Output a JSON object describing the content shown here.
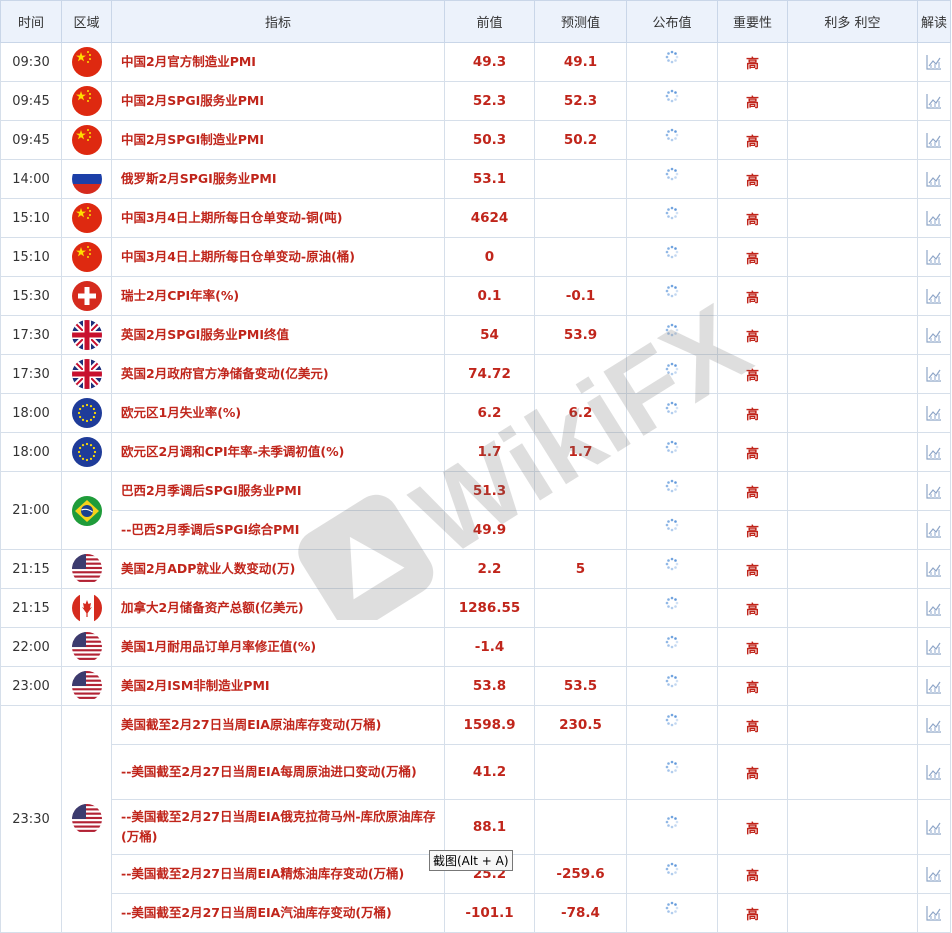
{
  "headers": {
    "time": "时间",
    "region": "区域",
    "indicator": "指标",
    "prev": "前值",
    "forecast": "预测值",
    "actual": "公布值",
    "importance": "重要性",
    "impact": "利多 利空",
    "analysis": "解读"
  },
  "rows": [
    {
      "time": "09:30",
      "name": "中国2月官方制造业PMI",
      "prev": "49.3",
      "forecast": "49.1",
      "importance": "高"
    },
    {
      "time": "09:45",
      "name": "中国2月SPGI服务业PMI",
      "prev": "52.3",
      "forecast": "52.3",
      "importance": "高"
    },
    {
      "time": "09:45",
      "name": "中国2月SPGI制造业PMI",
      "prev": "50.3",
      "forecast": "50.2",
      "importance": "高"
    },
    {
      "time": "14:00",
      "name": "俄罗斯2月SPGI服务业PMI",
      "prev": "53.1",
      "forecast": "",
      "importance": "高"
    },
    {
      "time": "15:10",
      "name": "中国3月4日上期所每日仓单变动-铜(吨)",
      "prev": "4624",
      "forecast": "",
      "importance": "高"
    },
    {
      "time": "15:10",
      "name": "中国3月4日上期所每日仓单变动-原油(桶)",
      "prev": "0",
      "forecast": "",
      "importance": "高"
    },
    {
      "time": "15:30",
      "name": "瑞士2月CPI年率(%)",
      "prev": "0.1",
      "forecast": "-0.1",
      "importance": "高"
    },
    {
      "time": "17:30",
      "name": "英国2月SPGI服务业PMI终值",
      "prev": "54",
      "forecast": "53.9",
      "importance": "高"
    },
    {
      "time": "17:30",
      "name": "英国2月政府官方净储备变动(亿美元)",
      "prev": "74.72",
      "forecast": "",
      "importance": "高"
    },
    {
      "time": "18:00",
      "name": "欧元区1月失业率(%)",
      "prev": "6.2",
      "forecast": "6.2",
      "importance": "高"
    },
    {
      "time": "18:00",
      "name": "欧元区2月调和CPI年率-未季调初值(%)",
      "prev": "1.7",
      "forecast": "1.7",
      "importance": "高"
    },
    {
      "time": "21:00",
      "name": "巴西2月季调后SPGI服务业PMI",
      "prev": "51.3",
      "forecast": "",
      "importance": "高"
    },
    {
      "time": "",
      "name": "--巴西2月季调后SPGI综合PMI",
      "prev": "49.9",
      "forecast": "",
      "importance": "高"
    },
    {
      "time": "21:15",
      "name": "美国2月ADP就业人数变动(万)",
      "prev": "2.2",
      "forecast": "5",
      "importance": "高"
    },
    {
      "time": "21:15",
      "name": "加拿大2月储备资产总额(亿美元)",
      "prev": "1286.55",
      "forecast": "",
      "importance": "高"
    },
    {
      "time": "22:00",
      "name": "美国1月耐用品订单月率修正值(%)",
      "prev": "-1.4",
      "forecast": "",
      "importance": "高"
    },
    {
      "time": "23:00",
      "name": "美国2月ISM非制造业PMI",
      "prev": "53.8",
      "forecast": "53.5",
      "importance": "高"
    },
    {
      "time": "23:30",
      "name": "美国截至2月27日当周EIA原油库存变动(万桶)",
      "prev": "1598.9",
      "forecast": "230.5",
      "importance": "高"
    },
    {
      "time": "",
      "name": "--美国截至2月27日当周EIA每周原油进口变动(万桶)",
      "prev": "41.2",
      "forecast": "",
      "importance": "高"
    },
    {
      "time": "",
      "name": "--美国截至2月27日当周EIA俄克拉荷马州-库欣原油库存(万桶)",
      "prev": "88.1",
      "forecast": "",
      "importance": "高"
    },
    {
      "time": "",
      "name": "--美国截至2月27日当周EIA精炼油库存变动(万桶)",
      "prev": "25.2",
      "forecast": "-259.6",
      "importance": "高"
    },
    {
      "time": "",
      "name": "--美国截至2月27日当周EIA汽油库存变动(万桶)",
      "prev": "-101.1",
      "forecast": "-78.4",
      "importance": "高"
    }
  ],
  "icons": {
    "actual_pending": "loading-spinner-icon",
    "analysis": "chart-icon"
  },
  "flags": [
    "china",
    "china",
    "china",
    "russia",
    "china",
    "china",
    "switzerland",
    "uk",
    "uk",
    "eu",
    "eu",
    "brazil",
    "usa",
    "canada",
    "usa",
    "usa",
    "usa"
  ],
  "watermark_text": "WikiFX",
  "tooltip": "截图(Alt + A)",
  "colors": {
    "accent_red": "#c0251b",
    "header_bg": "#ecf2fb",
    "border": "#d6dfea"
  }
}
